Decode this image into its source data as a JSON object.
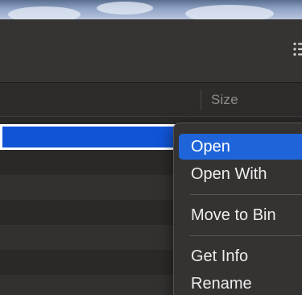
{
  "list_header": {
    "size_column_label": "Size"
  },
  "context_menu": {
    "items": [
      {
        "label": "Open",
        "highlighted": true
      },
      {
        "label": "Open With",
        "highlighted": false
      },
      {
        "label": "Move to Bin",
        "highlighted": false
      },
      {
        "label": "Get Info",
        "highlighted": false
      },
      {
        "label": "Rename",
        "highlighted": false
      }
    ]
  },
  "icons": {
    "toolbar_right": "view-options-icon"
  },
  "colors": {
    "selection": "#1254d6",
    "menu_highlight": "#1f65d9",
    "window_background": "#2b2928"
  }
}
